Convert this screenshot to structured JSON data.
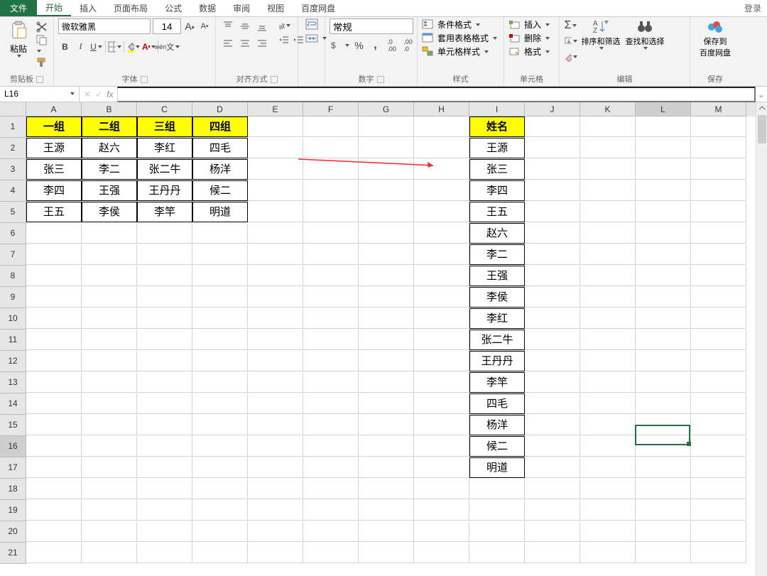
{
  "menu": {
    "file": "文件",
    "tabs": [
      "开始",
      "插入",
      "页面布局",
      "公式",
      "数据",
      "审阅",
      "视图",
      "百度网盘"
    ],
    "active": 0,
    "login": "登录"
  },
  "ribbon": {
    "clipboard": {
      "label": "剪贴板",
      "paste": "粘贴"
    },
    "font": {
      "label": "字体",
      "name": "微软雅黑",
      "size": "14"
    },
    "alignment": {
      "label": "对齐方式",
      "wrap": "自动换行",
      "merge": "合并后居中"
    },
    "number": {
      "label": "数字",
      "format": "常规"
    },
    "styles": {
      "label": "样式",
      "cond": "条件格式",
      "tablefmt": "套用表格格式",
      "cellfmt": "单元格样式"
    },
    "cells": {
      "label": "单元格",
      "insert": "插入",
      "delete": "删除",
      "format": "格式"
    },
    "editing": {
      "label": "编辑",
      "sort": "排序和筛选",
      "find": "查找和选择"
    },
    "save": {
      "label": "保存",
      "btn": "保存到\n百度网盘"
    }
  },
  "namebox": "L16",
  "columns": [
    "A",
    "B",
    "C",
    "D",
    "E",
    "F",
    "G",
    "H",
    "I",
    "J",
    "K",
    "L",
    "M"
  ],
  "table1": {
    "headers": [
      "一组",
      "二组",
      "三组",
      "四组"
    ],
    "rows": [
      [
        "王源",
        "赵六",
        "李红",
        "四毛"
      ],
      [
        "张三",
        "李二",
        "张二牛",
        "杨洋"
      ],
      [
        "李四",
        "王强",
        "王丹丹",
        "候二"
      ],
      [
        "王五",
        "李侯",
        "李竿",
        "明道"
      ]
    ]
  },
  "table2": {
    "header": "姓名",
    "rows": [
      "王源",
      "张三",
      "李四",
      "王五",
      "赵六",
      "李二",
      "王强",
      "李侯",
      "李红",
      "张二牛",
      "王丹丹",
      "李竿",
      "四毛",
      "杨洋",
      "候二",
      "明道"
    ]
  },
  "row_count": 21,
  "selected": {
    "row": 16,
    "col": "L"
  }
}
